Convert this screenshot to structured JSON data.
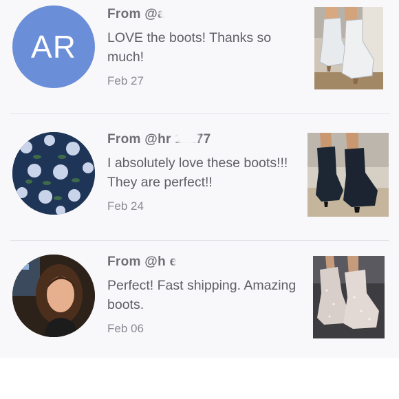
{
  "reviews": [
    {
      "from": "From @a   9",
      "message": "LOVE the boots! Thanks so much!",
      "date": "Feb 27",
      "avatar_initials": "AR",
      "avatar_color": "#6b8ed8",
      "product": "white cowboy boots"
    },
    {
      "from": "From @hr      11177",
      "message": "I absolutely love these boots!!! They are perfect!!",
      "date": "Feb 24",
      "avatar_color": "#1f3558",
      "product": "black cowboy boots"
    },
    {
      "from": "From @h         er",
      "message": "Perfect! Fast shipping. Amazing boots.",
      "date": "Feb 06",
      "avatar_color": "#3a2a1c",
      "product": "silver sparkle boots"
    }
  ]
}
